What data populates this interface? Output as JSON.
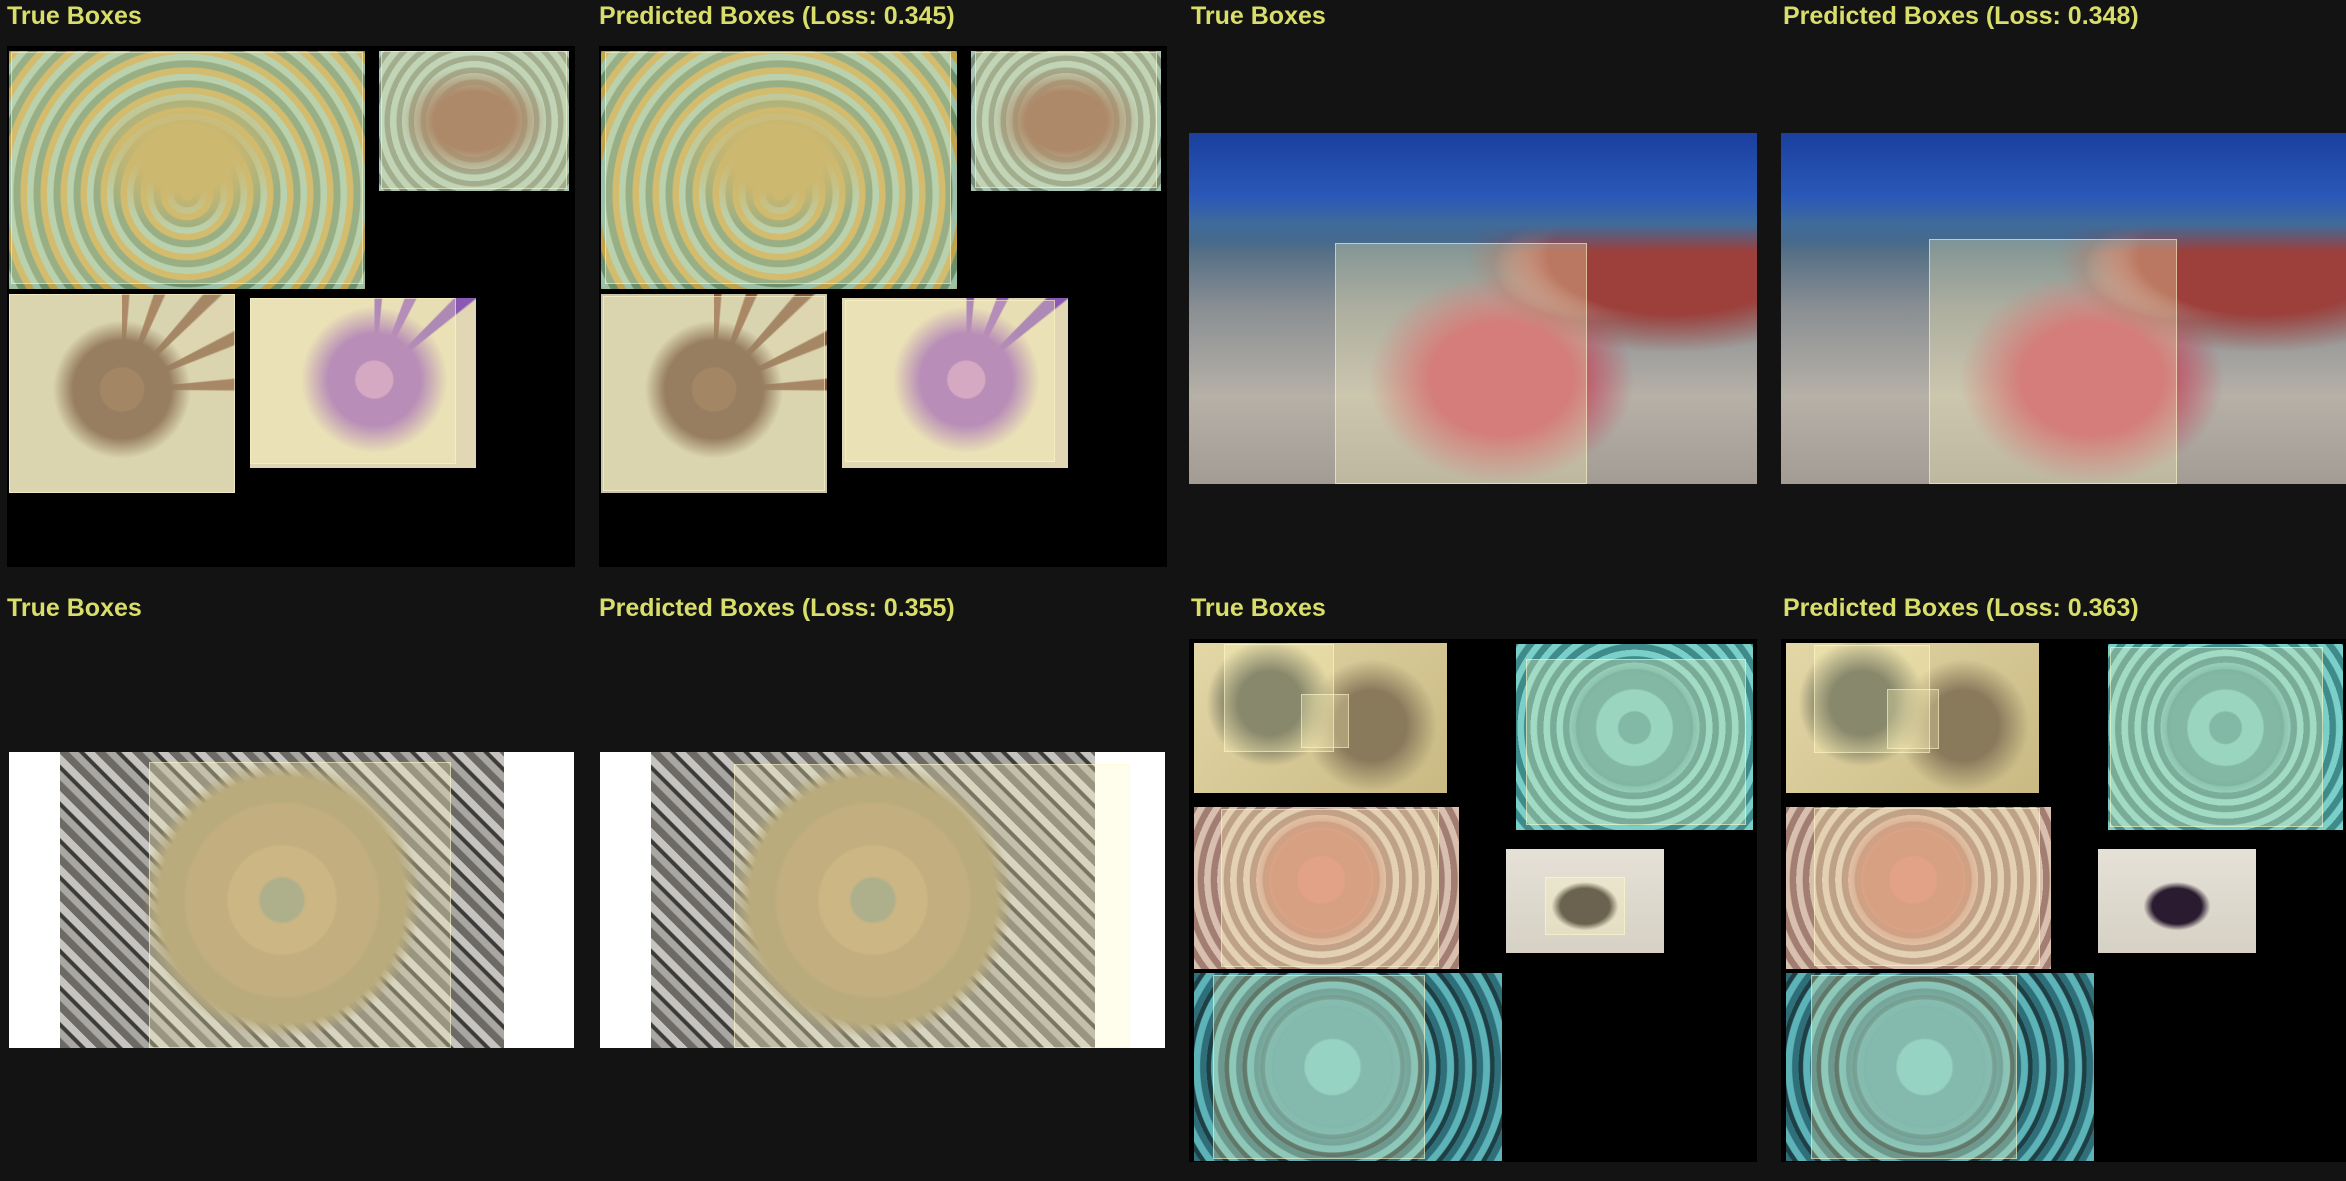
{
  "panels": [
    {
      "title": "True Boxes"
    },
    {
      "title": "Predicted Boxes (Loss: 0.345)"
    },
    {
      "title": "True Boxes"
    },
    {
      "title": "Predicted Boxes (Loss: 0.348)"
    },
    {
      "title": "True Boxes"
    },
    {
      "title": "Predicted Boxes (Loss: 0.355)"
    },
    {
      "title": "True Boxes"
    },
    {
      "title": "Predicted Boxes (Loss: 0.363)"
    }
  ],
  "colors": {
    "background": "#131313",
    "title_text": "#d9de6a",
    "box_fill": "rgba(255,247,190,0.30)"
  }
}
